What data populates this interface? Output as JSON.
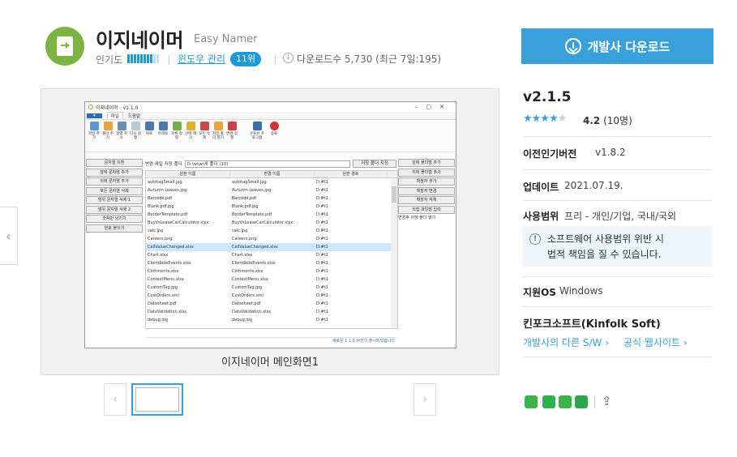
{
  "app": {
    "name": "이지네이머",
    "name_en": "Easy Namer"
  },
  "meta": {
    "popularity_label": "인기도",
    "popularity_level": 0.8,
    "category_link": "윈도우 관리",
    "rank_badge": "11위",
    "downloads": "다운로드수 5,730 (최근 7일:195)"
  },
  "download_button": {
    "label": "개발사 다운로드"
  },
  "screenshot": {
    "caption": "이지네이머 메인화면1",
    "window_title": "이지네이머 - v1.1.0",
    "menu": [
      "파일",
      "도움말"
    ],
    "ribbon": [
      "파일 추가",
      "폴더 추가",
      "실행 취소",
      "다시 실행",
      "위로",
      "아래로",
      "목록 정렬",
      "선택 제거",
      "모두 삭제",
      "저장 폴더 열기",
      "변경 실행",
      "유튜브 프로그램",
      "종료"
    ],
    "path_label": "변경 파일 저장 폴더",
    "path_value": "D:\\wtw\\새 폴더 (10)",
    "path_button": "저장 폴더 지정",
    "left_buttons": [
      "문자열 치환",
      "앞에 문자열 추가",
      "뒤에 문자열 추가",
      "모든 문자열 삭제",
      "범위 문자열 삭제 1",
      "범위 문자열 삭제 2",
      "숫자만 남기기",
      "번호 붙이기"
    ],
    "right_buttons": [
      "앞에 폴더명 추가",
      "뒤에 폴더명 추가",
      "확장자 추가",
      "확장자 변경",
      "확장자 삭제",
      "직접 파일명 입력",
      "변경후 저장 폴더 열기"
    ],
    "columns": [
      "원본 이름",
      "변경 이름",
      "원본 경로"
    ],
    "rows": [
      [
        "autotagSmall.jpg",
        "autotagSmall.jpg",
        "D:#t1"
      ],
      [
        "Autumn Leaves.jpg",
        "Autumn Leaves.jpg",
        "D:#t1"
      ],
      [
        "Barcode.pdf",
        "Barcode.pdf",
        "D:#t1"
      ],
      [
        "Blank.pdf.jpg",
        "Blank.pdf.jpg",
        "D:#t1"
      ],
      [
        "BorderTemplate.pdf",
        "BorderTemplate.pdf",
        "D:#t1"
      ],
      [
        "BuyVsLeaseCarCalculator.xlsx",
        "BuyVsLeaseCarCalculator.xlsx",
        "D:#t1"
      ],
      [
        "calc.jpg",
        "calc.jpg",
        "D:#t1"
      ],
      [
        "Careers.png",
        "Careers.png",
        "D:#t1"
      ],
      [
        "CellValueChanged.xlsx",
        "CellValueChanged.xlsx",
        "D:#t1"
      ],
      [
        "Chart.xlsx",
        "Chart.xlsx",
        "D:#t1"
      ],
      [
        "ClientSideEvents.xlsx",
        "ClientSideEvents.xlsx",
        "D:#t1"
      ],
      [
        "Comments.xlsx",
        "Comments.xlsx",
        "D:#t1"
      ],
      [
        "ContextMenu.xlsx",
        "ContextMenu.xlsx",
        "D:#t1"
      ],
      [
        "CustomTag.jpg",
        "CustomTag.jpg",
        "D:#t1"
      ],
      [
        "CustOrders.xml",
        "CustOrders.xml",
        "D:#t1"
      ],
      [
        "Datasheet.pdf",
        "Datasheet.pdf",
        "D:#t1"
      ],
      [
        "DataValidation.xlsx",
        "DataValidation.xlsx",
        "D:#t1"
      ],
      [
        "debug.log",
        "debug.log",
        "D:#t1"
      ]
    ],
    "selected_row": 8,
    "status": "새로운 1.1.0 버전이 출시되었습니다"
  },
  "info": {
    "version": "v2.1.5",
    "stars": "★★★★",
    "stars_off": "★",
    "rating": "4.2",
    "rating_count": "(10명)",
    "prev_label": "이전인기버전",
    "prev_value": "v1.8.2",
    "update_label": "업데이트",
    "update_value": "2021.07.19.",
    "license_label": "사용범위",
    "license_value": "프리 - 개인/기업, 국내/국외",
    "notice_line1": "소프트웨어 사용범위 위반 시",
    "notice_line2": "법적 책임을 질 수 있습니다.",
    "os_label": "지원OS",
    "os_value": "Windows",
    "developer": "킨포크소프트(Kinfolk Soft)",
    "dev_other": "개발사의 다른 S/W ›",
    "dev_site": "공식 웹사이트 ›"
  },
  "colors": {
    "accent": "#3aa0da",
    "app_icon": "#7cb342"
  }
}
